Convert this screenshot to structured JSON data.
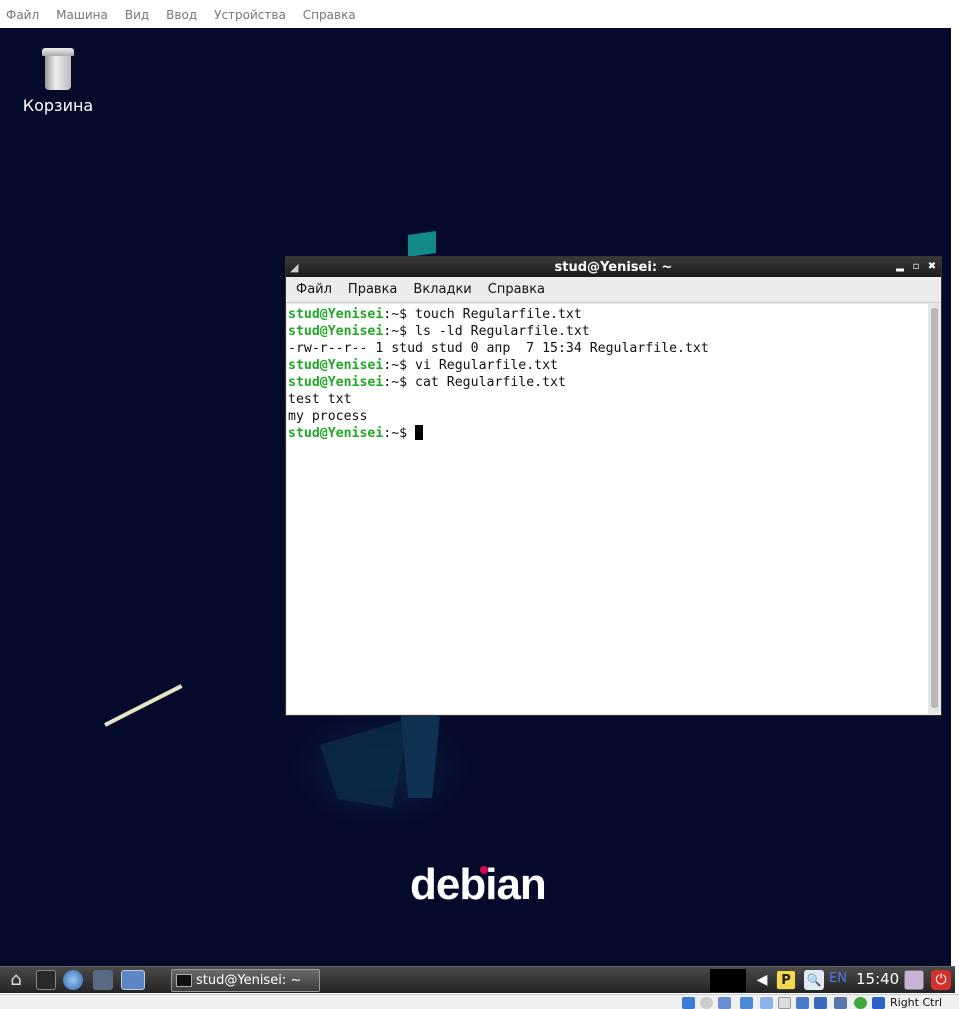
{
  "host_menu": [
    "Файл",
    "Машина",
    "Вид",
    "Ввод",
    "Устройства",
    "Справка"
  ],
  "desktop": {
    "trash_label": "Корзина",
    "logo_text": "debian"
  },
  "terminal": {
    "title": "stud@Yenisei: ~",
    "menu": [
      "Файл",
      "Правка",
      "Вкладки",
      "Справка"
    ],
    "prompt_user": "stud@Yenisei",
    "prompt_path": ":~$ ",
    "lines": [
      {
        "type": "prompt",
        "cmd": "touch Regularfile.txt"
      },
      {
        "type": "prompt",
        "cmd": "ls -ld Regularfile.txt"
      },
      {
        "type": "output",
        "text": "-rw-r--r-- 1 stud stud 0 апр  7 15:34 Regularfile.txt"
      },
      {
        "type": "prompt",
        "cmd": "vi Regularfile.txt"
      },
      {
        "type": "prompt",
        "cmd": "cat Regularfile.txt"
      },
      {
        "type": "output",
        "text": "test txt"
      },
      {
        "type": "output",
        "text": "my process"
      },
      {
        "type": "prompt",
        "cmd": ""
      }
    ]
  },
  "taskbar": {
    "task_label": "stud@Yenisei: ~",
    "language": "EN",
    "clock": "15:40",
    "p_icon_letter": "P"
  },
  "statusbar": {
    "host_key": "Right Ctrl"
  }
}
